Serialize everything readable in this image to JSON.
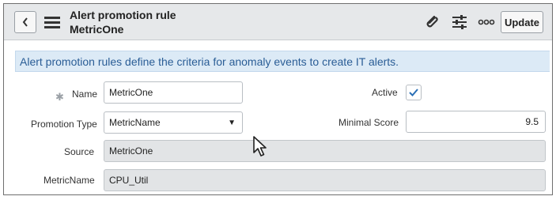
{
  "header": {
    "title": "Alert promotion rule",
    "subtitle": "MetricOne",
    "back_icon": "chevron-left-icon",
    "menu_icon": "hamburger-menu-icon",
    "actions": [
      "paperclip-icon",
      "settings-sliders-icon",
      "more-icon"
    ],
    "update_label": "Update"
  },
  "banner": {
    "text": "Alert promotion rules define the criteria for anomaly events to create IT alerts."
  },
  "form": {
    "name": {
      "label": "Name",
      "value": "MetricOne",
      "required": true
    },
    "active": {
      "label": "Active",
      "checked": true
    },
    "promotion_type": {
      "label": "Promotion Type",
      "value": "MetricName"
    },
    "minimal_score": {
      "label": "Minimal Score",
      "value": "9.5"
    },
    "source": {
      "label": "Source",
      "value": "MetricOne"
    },
    "metric_name": {
      "label": "MetricName",
      "value": "CPU_Util"
    }
  },
  "colors": {
    "banner_bg": "#dceaf6",
    "banner_text": "#2a5d96",
    "header_bg": "#e6e8ea",
    "readonly_bg": "#e2e4e6"
  }
}
